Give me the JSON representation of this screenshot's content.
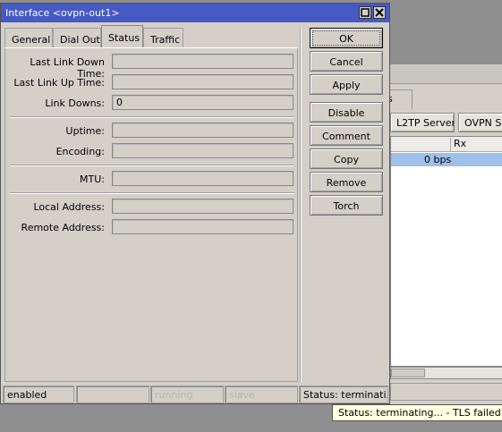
{
  "background_window": {
    "tab_partial": "s",
    "buttons": [
      "L2TP Server",
      "OVPN Se"
    ],
    "column_rx": "Rx",
    "row_value": "0 bps"
  },
  "window": {
    "title": "Interface <ovpn-out1>",
    "tabs": [
      "General",
      "Dial Out",
      "Status",
      "Traffic"
    ],
    "active_tab": "Status"
  },
  "status": {
    "last_link_down_time_label": "Last Link Down Time:",
    "last_link_down_time": "",
    "last_link_up_time_label": "Last Link Up Time:",
    "last_link_up_time": "",
    "link_downs_label": "Link Downs:",
    "link_downs": "0",
    "uptime_label": "Uptime:",
    "uptime": "",
    "encoding_label": "Encoding:",
    "encoding": "",
    "mtu_label": "MTU:",
    "mtu": "",
    "local_address_label": "Local Address:",
    "local_address": "",
    "remote_address_label": "Remote Address:",
    "remote_address": ""
  },
  "buttons": {
    "ok": "OK",
    "cancel": "Cancel",
    "apply": "Apply",
    "disable": "Disable",
    "comment": "Comment",
    "copy": "Copy",
    "remove": "Remove",
    "torch": "Torch"
  },
  "statusbar": {
    "enabled": "enabled",
    "blank": "",
    "running": "running",
    "slave": "slave",
    "status": "Status: terminati..."
  },
  "tooltip": "Status: terminating... - TLS failed"
}
